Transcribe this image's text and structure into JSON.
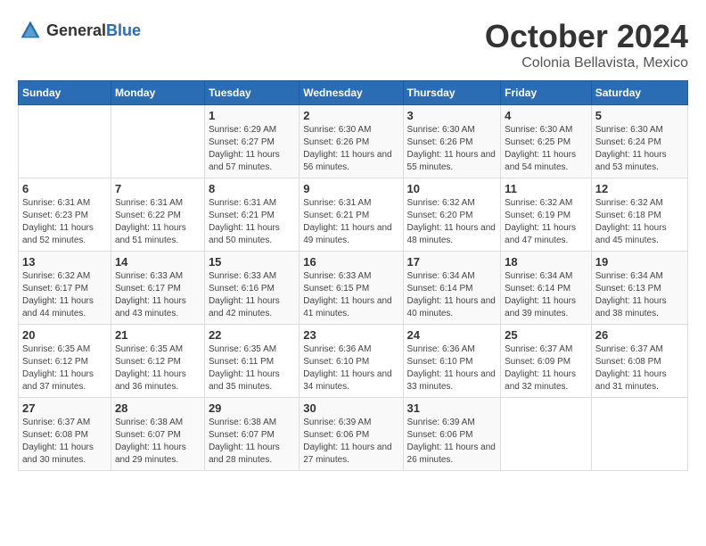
{
  "header": {
    "logo_general": "General",
    "logo_blue": "Blue",
    "month_title": "October 2024",
    "subtitle": "Colonia Bellavista, Mexico"
  },
  "weekdays": [
    "Sunday",
    "Monday",
    "Tuesday",
    "Wednesday",
    "Thursday",
    "Friday",
    "Saturday"
  ],
  "weeks": [
    [
      {
        "day": "",
        "info": ""
      },
      {
        "day": "",
        "info": ""
      },
      {
        "day": "1",
        "info": "Sunrise: 6:29 AM\nSunset: 6:27 PM\nDaylight: 11 hours and 57 minutes."
      },
      {
        "day": "2",
        "info": "Sunrise: 6:30 AM\nSunset: 6:26 PM\nDaylight: 11 hours and 56 minutes."
      },
      {
        "day": "3",
        "info": "Sunrise: 6:30 AM\nSunset: 6:26 PM\nDaylight: 11 hours and 55 minutes."
      },
      {
        "day": "4",
        "info": "Sunrise: 6:30 AM\nSunset: 6:25 PM\nDaylight: 11 hours and 54 minutes."
      },
      {
        "day": "5",
        "info": "Sunrise: 6:30 AM\nSunset: 6:24 PM\nDaylight: 11 hours and 53 minutes."
      }
    ],
    [
      {
        "day": "6",
        "info": "Sunrise: 6:31 AM\nSunset: 6:23 PM\nDaylight: 11 hours and 52 minutes."
      },
      {
        "day": "7",
        "info": "Sunrise: 6:31 AM\nSunset: 6:22 PM\nDaylight: 11 hours and 51 minutes."
      },
      {
        "day": "8",
        "info": "Sunrise: 6:31 AM\nSunset: 6:21 PM\nDaylight: 11 hours and 50 minutes."
      },
      {
        "day": "9",
        "info": "Sunrise: 6:31 AM\nSunset: 6:21 PM\nDaylight: 11 hours and 49 minutes."
      },
      {
        "day": "10",
        "info": "Sunrise: 6:32 AM\nSunset: 6:20 PM\nDaylight: 11 hours and 48 minutes."
      },
      {
        "day": "11",
        "info": "Sunrise: 6:32 AM\nSunset: 6:19 PM\nDaylight: 11 hours and 47 minutes."
      },
      {
        "day": "12",
        "info": "Sunrise: 6:32 AM\nSunset: 6:18 PM\nDaylight: 11 hours and 45 minutes."
      }
    ],
    [
      {
        "day": "13",
        "info": "Sunrise: 6:32 AM\nSunset: 6:17 PM\nDaylight: 11 hours and 44 minutes."
      },
      {
        "day": "14",
        "info": "Sunrise: 6:33 AM\nSunset: 6:17 PM\nDaylight: 11 hours and 43 minutes."
      },
      {
        "day": "15",
        "info": "Sunrise: 6:33 AM\nSunset: 6:16 PM\nDaylight: 11 hours and 42 minutes."
      },
      {
        "day": "16",
        "info": "Sunrise: 6:33 AM\nSunset: 6:15 PM\nDaylight: 11 hours and 41 minutes."
      },
      {
        "day": "17",
        "info": "Sunrise: 6:34 AM\nSunset: 6:14 PM\nDaylight: 11 hours and 40 minutes."
      },
      {
        "day": "18",
        "info": "Sunrise: 6:34 AM\nSunset: 6:14 PM\nDaylight: 11 hours and 39 minutes."
      },
      {
        "day": "19",
        "info": "Sunrise: 6:34 AM\nSunset: 6:13 PM\nDaylight: 11 hours and 38 minutes."
      }
    ],
    [
      {
        "day": "20",
        "info": "Sunrise: 6:35 AM\nSunset: 6:12 PM\nDaylight: 11 hours and 37 minutes."
      },
      {
        "day": "21",
        "info": "Sunrise: 6:35 AM\nSunset: 6:12 PM\nDaylight: 11 hours and 36 minutes."
      },
      {
        "day": "22",
        "info": "Sunrise: 6:35 AM\nSunset: 6:11 PM\nDaylight: 11 hours and 35 minutes."
      },
      {
        "day": "23",
        "info": "Sunrise: 6:36 AM\nSunset: 6:10 PM\nDaylight: 11 hours and 34 minutes."
      },
      {
        "day": "24",
        "info": "Sunrise: 6:36 AM\nSunset: 6:10 PM\nDaylight: 11 hours and 33 minutes."
      },
      {
        "day": "25",
        "info": "Sunrise: 6:37 AM\nSunset: 6:09 PM\nDaylight: 11 hours and 32 minutes."
      },
      {
        "day": "26",
        "info": "Sunrise: 6:37 AM\nSunset: 6:08 PM\nDaylight: 11 hours and 31 minutes."
      }
    ],
    [
      {
        "day": "27",
        "info": "Sunrise: 6:37 AM\nSunset: 6:08 PM\nDaylight: 11 hours and 30 minutes."
      },
      {
        "day": "28",
        "info": "Sunrise: 6:38 AM\nSunset: 6:07 PM\nDaylight: 11 hours and 29 minutes."
      },
      {
        "day": "29",
        "info": "Sunrise: 6:38 AM\nSunset: 6:07 PM\nDaylight: 11 hours and 28 minutes."
      },
      {
        "day": "30",
        "info": "Sunrise: 6:39 AM\nSunset: 6:06 PM\nDaylight: 11 hours and 27 minutes."
      },
      {
        "day": "31",
        "info": "Sunrise: 6:39 AM\nSunset: 6:06 PM\nDaylight: 11 hours and 26 minutes."
      },
      {
        "day": "",
        "info": ""
      },
      {
        "day": "",
        "info": ""
      }
    ]
  ]
}
